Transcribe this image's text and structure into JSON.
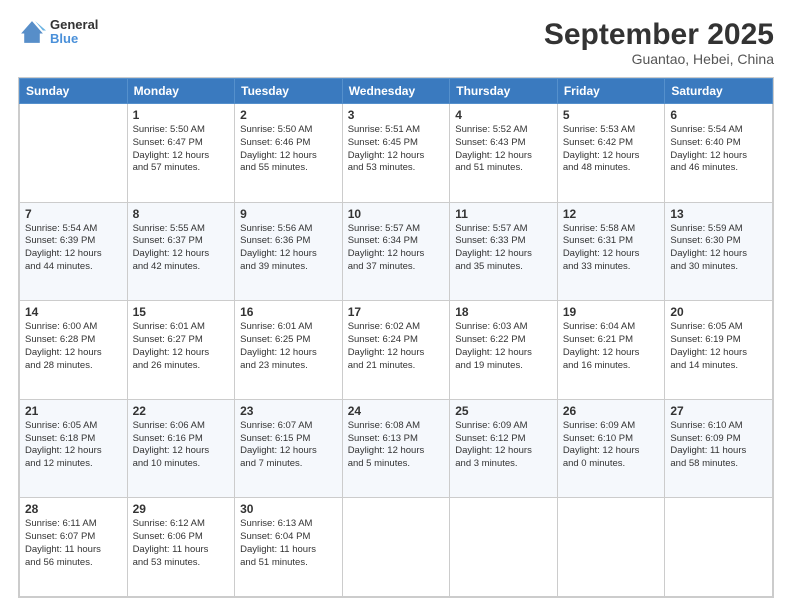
{
  "logo": {
    "line1": "General",
    "line2": "Blue"
  },
  "header": {
    "month": "September 2025",
    "location": "Guantao, Hebei, China"
  },
  "weekdays": [
    "Sunday",
    "Monday",
    "Tuesday",
    "Wednesday",
    "Thursday",
    "Friday",
    "Saturday"
  ],
  "weeks": [
    [
      {
        "day": "",
        "info": ""
      },
      {
        "day": "1",
        "info": "Sunrise: 5:50 AM\nSunset: 6:47 PM\nDaylight: 12 hours\nand 57 minutes."
      },
      {
        "day": "2",
        "info": "Sunrise: 5:50 AM\nSunset: 6:46 PM\nDaylight: 12 hours\nand 55 minutes."
      },
      {
        "day": "3",
        "info": "Sunrise: 5:51 AM\nSunset: 6:45 PM\nDaylight: 12 hours\nand 53 minutes."
      },
      {
        "day": "4",
        "info": "Sunrise: 5:52 AM\nSunset: 6:43 PM\nDaylight: 12 hours\nand 51 minutes."
      },
      {
        "day": "5",
        "info": "Sunrise: 5:53 AM\nSunset: 6:42 PM\nDaylight: 12 hours\nand 48 minutes."
      },
      {
        "day": "6",
        "info": "Sunrise: 5:54 AM\nSunset: 6:40 PM\nDaylight: 12 hours\nand 46 minutes."
      }
    ],
    [
      {
        "day": "7",
        "info": "Sunrise: 5:54 AM\nSunset: 6:39 PM\nDaylight: 12 hours\nand 44 minutes."
      },
      {
        "day": "8",
        "info": "Sunrise: 5:55 AM\nSunset: 6:37 PM\nDaylight: 12 hours\nand 42 minutes."
      },
      {
        "day": "9",
        "info": "Sunrise: 5:56 AM\nSunset: 6:36 PM\nDaylight: 12 hours\nand 39 minutes."
      },
      {
        "day": "10",
        "info": "Sunrise: 5:57 AM\nSunset: 6:34 PM\nDaylight: 12 hours\nand 37 minutes."
      },
      {
        "day": "11",
        "info": "Sunrise: 5:57 AM\nSunset: 6:33 PM\nDaylight: 12 hours\nand 35 minutes."
      },
      {
        "day": "12",
        "info": "Sunrise: 5:58 AM\nSunset: 6:31 PM\nDaylight: 12 hours\nand 33 minutes."
      },
      {
        "day": "13",
        "info": "Sunrise: 5:59 AM\nSunset: 6:30 PM\nDaylight: 12 hours\nand 30 minutes."
      }
    ],
    [
      {
        "day": "14",
        "info": "Sunrise: 6:00 AM\nSunset: 6:28 PM\nDaylight: 12 hours\nand 28 minutes."
      },
      {
        "day": "15",
        "info": "Sunrise: 6:01 AM\nSunset: 6:27 PM\nDaylight: 12 hours\nand 26 minutes."
      },
      {
        "day": "16",
        "info": "Sunrise: 6:01 AM\nSunset: 6:25 PM\nDaylight: 12 hours\nand 23 minutes."
      },
      {
        "day": "17",
        "info": "Sunrise: 6:02 AM\nSunset: 6:24 PM\nDaylight: 12 hours\nand 21 minutes."
      },
      {
        "day": "18",
        "info": "Sunrise: 6:03 AM\nSunset: 6:22 PM\nDaylight: 12 hours\nand 19 minutes."
      },
      {
        "day": "19",
        "info": "Sunrise: 6:04 AM\nSunset: 6:21 PM\nDaylight: 12 hours\nand 16 minutes."
      },
      {
        "day": "20",
        "info": "Sunrise: 6:05 AM\nSunset: 6:19 PM\nDaylight: 12 hours\nand 14 minutes."
      }
    ],
    [
      {
        "day": "21",
        "info": "Sunrise: 6:05 AM\nSunset: 6:18 PM\nDaylight: 12 hours\nand 12 minutes."
      },
      {
        "day": "22",
        "info": "Sunrise: 6:06 AM\nSunset: 6:16 PM\nDaylight: 12 hours\nand 10 minutes."
      },
      {
        "day": "23",
        "info": "Sunrise: 6:07 AM\nSunset: 6:15 PM\nDaylight: 12 hours\nand 7 minutes."
      },
      {
        "day": "24",
        "info": "Sunrise: 6:08 AM\nSunset: 6:13 PM\nDaylight: 12 hours\nand 5 minutes."
      },
      {
        "day": "25",
        "info": "Sunrise: 6:09 AM\nSunset: 6:12 PM\nDaylight: 12 hours\nand 3 minutes."
      },
      {
        "day": "26",
        "info": "Sunrise: 6:09 AM\nSunset: 6:10 PM\nDaylight: 12 hours\nand 0 minutes."
      },
      {
        "day": "27",
        "info": "Sunrise: 6:10 AM\nSunset: 6:09 PM\nDaylight: 11 hours\nand 58 minutes."
      }
    ],
    [
      {
        "day": "28",
        "info": "Sunrise: 6:11 AM\nSunset: 6:07 PM\nDaylight: 11 hours\nand 56 minutes."
      },
      {
        "day": "29",
        "info": "Sunrise: 6:12 AM\nSunset: 6:06 PM\nDaylight: 11 hours\nand 53 minutes."
      },
      {
        "day": "30",
        "info": "Sunrise: 6:13 AM\nSunset: 6:04 PM\nDaylight: 11 hours\nand 51 minutes."
      },
      {
        "day": "",
        "info": ""
      },
      {
        "day": "",
        "info": ""
      },
      {
        "day": "",
        "info": ""
      },
      {
        "day": "",
        "info": ""
      }
    ]
  ]
}
